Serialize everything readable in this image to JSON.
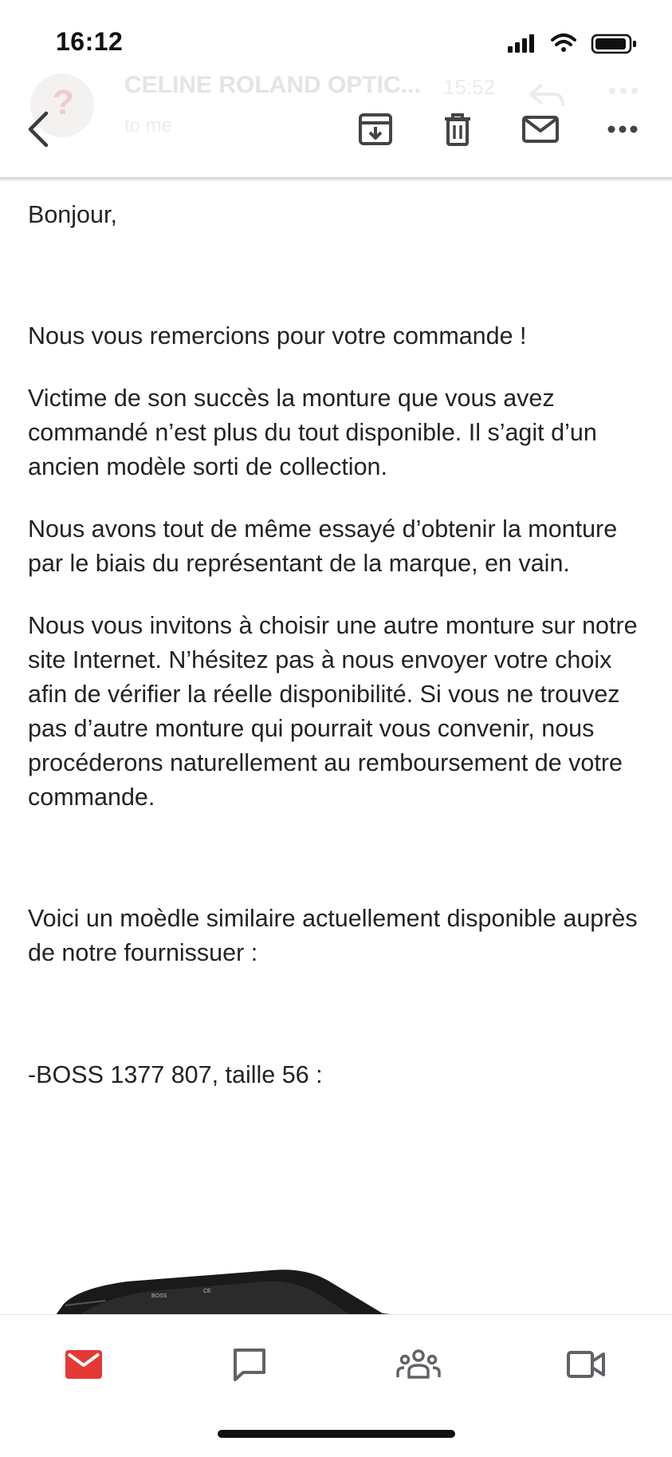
{
  "status_bar": {
    "time": "16:12"
  },
  "ghost_header": {
    "sender": "CELINE ROLAND OPTIC...",
    "time": "15:52",
    "recipient": "to me"
  },
  "toolbar": {
    "back": "back-icon",
    "archive": "archive-icon",
    "delete": "trash-icon",
    "mark_unread": "mail-icon",
    "more": "more-icon"
  },
  "email": {
    "greeting": "Bonjour,",
    "paragraphs": [
      "Nous vous remercions pour votre commande !",
      "Victime de son succès la monture que vous avez commandé n’est plus du tout disponible. Il s’agit d’un ancien modèle sorti de collection.",
      "Nous avons tout de même essayé d’obtenir la monture par le biais du représentant de la marque, en vain.",
      "Nous vous invitons à choisir une autre monture sur notre site Internet. N’hésitez pas à nous envoyer votre choix afin de vérifier la réelle disponibilité. Si vous ne trouvez pas d’autre monture qui pourrait vous convenir, nous procéderons naturellement au remboursement de votre commande.",
      "Voici un moèdle similaire actuellement disponible auprès de notre fournissuer :",
      "-BOSS 1377 807, taille 56 :"
    ],
    "image_brand": "BOSS",
    "image_mark": "CE"
  },
  "bottom_nav": {
    "items": [
      "mail-icon",
      "chat-icon",
      "spaces-icon",
      "meet-icon"
    ],
    "active_color": "#e53935",
    "inactive_color": "#5f6368"
  }
}
